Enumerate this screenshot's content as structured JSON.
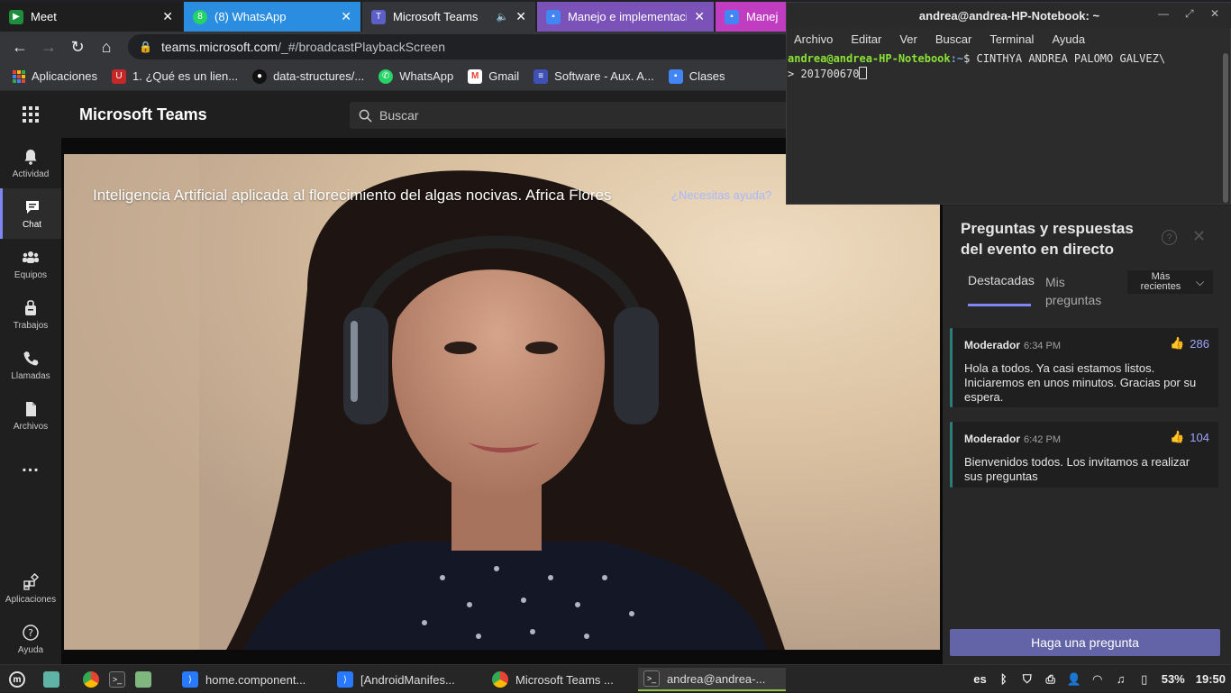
{
  "browser": {
    "tabs": [
      {
        "title": "Meet",
        "color": "#1e8e3e"
      },
      {
        "title": "(8) WhatsApp",
        "color": "#25d366"
      },
      {
        "title": "Microsoft Teams",
        "color": "#5b5fc7"
      },
      {
        "title": "Manejo e implementaci",
        "color": "#4285f4"
      },
      {
        "title": "Manejo",
        "color": "#4285f4"
      }
    ],
    "url_host": "teams.microsoft.com",
    "url_path": "/_#/broadcastPlaybackScreen",
    "bookmarks": [
      {
        "label": "Aplicaciones"
      },
      {
        "label": "1. ¿Qué es un lien..."
      },
      {
        "label": "data-structures/..."
      },
      {
        "label": "WhatsApp"
      },
      {
        "label": "Gmail"
      },
      {
        "label": "Software - Aux. A..."
      },
      {
        "label": "Clases"
      }
    ]
  },
  "teams": {
    "app_title": "Microsoft Teams",
    "search_placeholder": "Buscar",
    "rail": [
      {
        "label": "Actividad",
        "icon": "bell-icon"
      },
      {
        "label": "Chat",
        "icon": "chat-icon"
      },
      {
        "label": "Equipos",
        "icon": "teams-icon"
      },
      {
        "label": "Trabajos",
        "icon": "briefcase-icon"
      },
      {
        "label": "Llamadas",
        "icon": "phone-icon"
      },
      {
        "label": "Archivos",
        "icon": "file-icon"
      },
      {
        "label": "Aplicaciones",
        "icon": "apps-icon"
      },
      {
        "label": "Ayuda",
        "icon": "help-icon"
      }
    ],
    "more_label": "...",
    "event_title": "Inteligencia Artificial aplicada al florecimiento del algas nocivas. Africa Flores",
    "help_link": "¿Necesitas ayuda?"
  },
  "qa": {
    "title": "Preguntas y respuestas del evento en directo",
    "help_icon": "?",
    "close_icon": "✕",
    "tab_featured": "Destacadas",
    "tab_mine": "Mis preguntas",
    "sort_label": "Más recientes",
    "questions": [
      {
        "author": "Moderador",
        "time": "6:34 PM",
        "likes": "286",
        "text": "Hola a todos. Ya casi estamos listos. Iniciaremos en unos minutos. Gracias por su espera."
      },
      {
        "author": "Moderador",
        "time": "6:42 PM",
        "likes": "104",
        "text": "Bienvenidos todos. Los invitamos a realizar sus preguntas"
      }
    ],
    "ask_button": "Haga una pregunta"
  },
  "terminal": {
    "title": "andrea@andrea-HP-Notebook: ~",
    "menu": [
      "Archivo",
      "Editar",
      "Ver",
      "Buscar",
      "Terminal",
      "Ayuda"
    ],
    "prompt_user": "andrea@andrea-HP-Notebook",
    "prompt_path": ":~",
    "prompt_symbol": "$ ",
    "command": "CINTHYA ANDREA PALOMO GALVEZ\\",
    "continuation": "> 201700670"
  },
  "taskbar": {
    "apps": [
      {
        "label": "home.component...",
        "color": "#2979ff"
      },
      {
        "label": "[AndroidManifes...",
        "color": "#2979ff"
      },
      {
        "label": "Microsoft Teams ...",
        "color": "#ea4335"
      },
      {
        "label": "andrea@andrea-...",
        "color": "#333333"
      }
    ],
    "lang": "es",
    "battery": "53%",
    "clock": "19:50"
  }
}
